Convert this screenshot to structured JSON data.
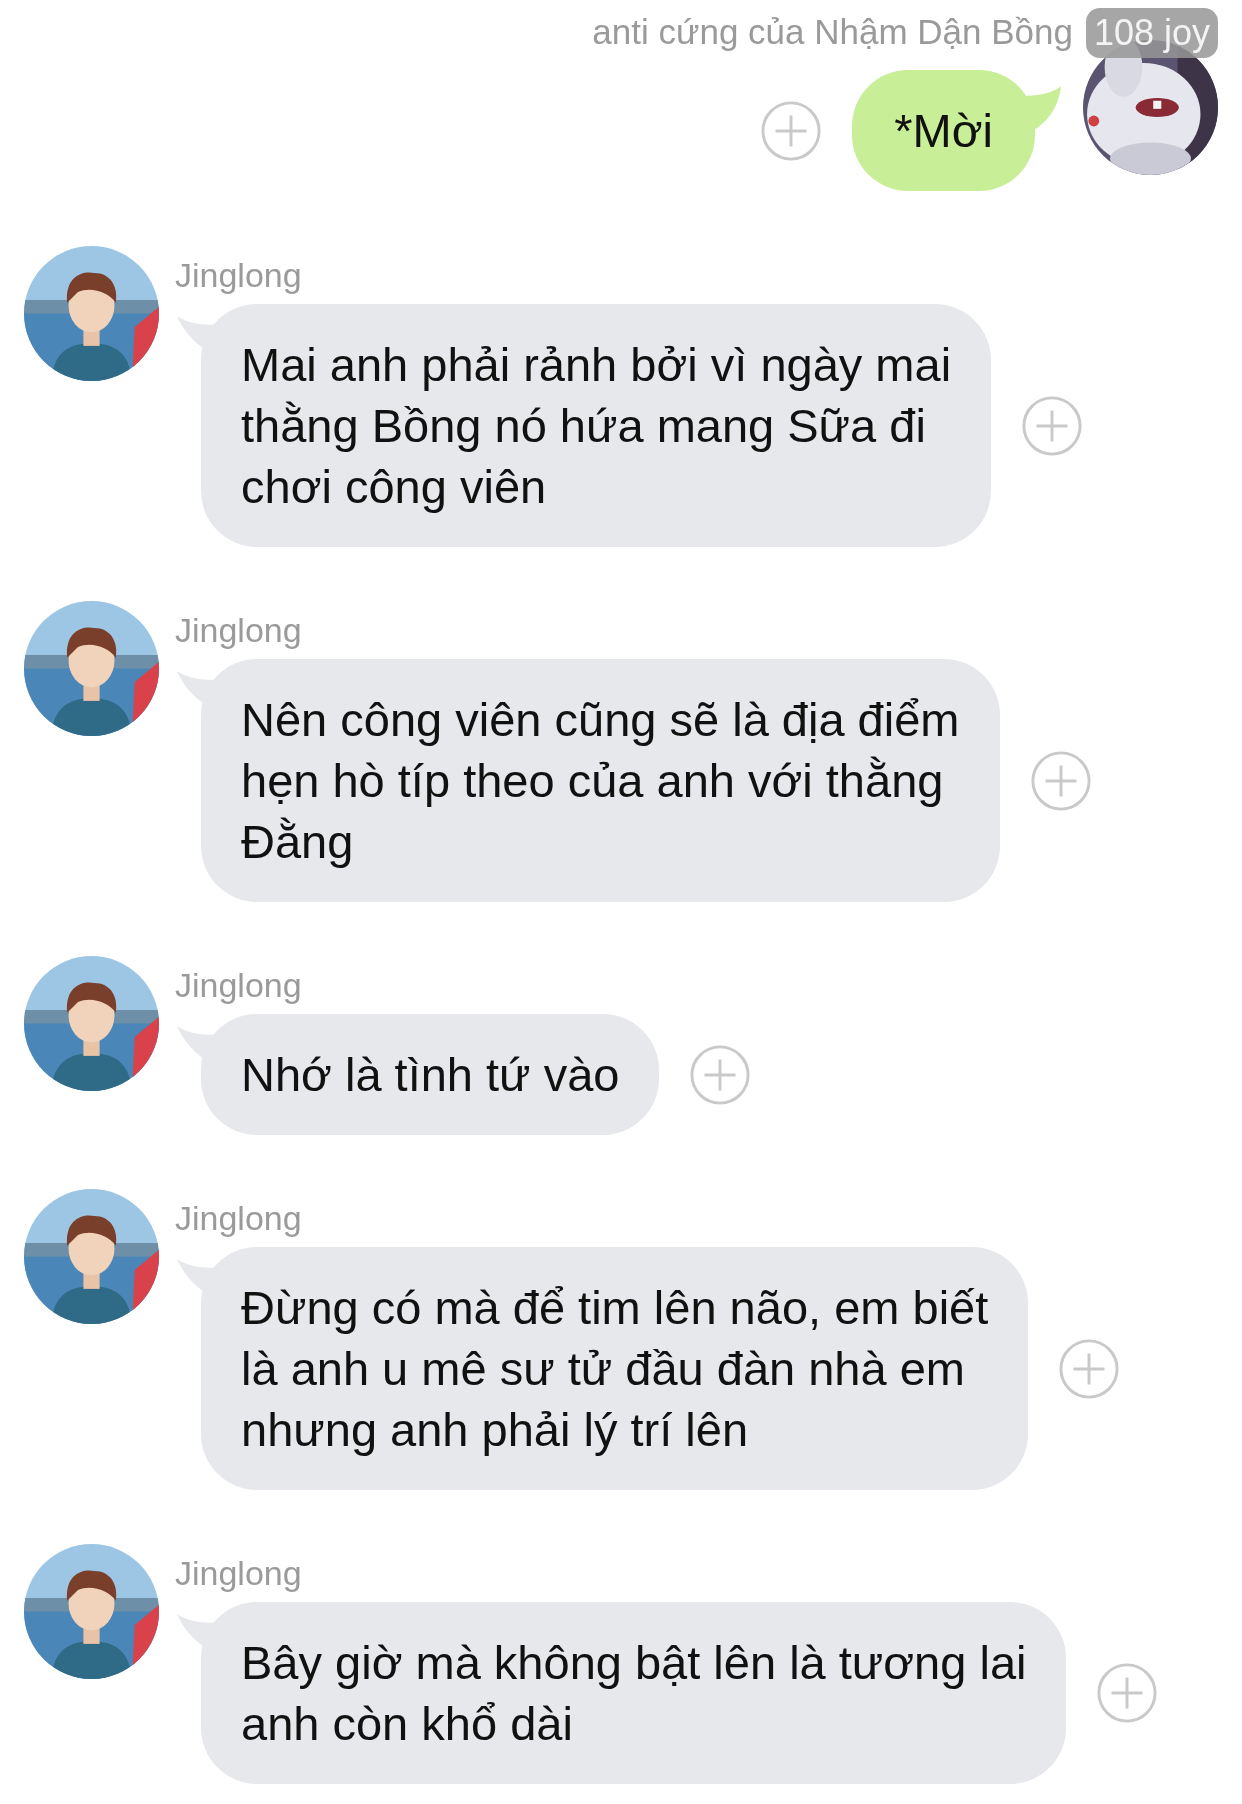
{
  "outgoing": {
    "sender": "anti cứng của Nhậm Dận Bồng",
    "badge": "108 joy",
    "text": "*Mời"
  },
  "messages": [
    {
      "sender": "Jinglong",
      "text": "Mai anh phải rảnh bởi vì ngày mai\nthằng Bồng nó hứa mang Sữa đi\nchơi công viên"
    },
    {
      "sender": "Jinglong",
      "text": "Nên công viên cũng sẽ là địa điểm\nhẹn hò típ theo của anh với thằng\nĐằng"
    },
    {
      "sender": "Jinglong",
      "text": "Nhớ là tình tứ vào"
    },
    {
      "sender": "Jinglong",
      "text": "Đừng có mà để tim lên não, em biết\nlà anh u mê sư tử đầu đàn nhà em\nnhưng anh phải lý trí lên"
    },
    {
      "sender": "Jinglong",
      "text": "Bây giờ mà không bật lên là tương lai\nanh còn khổ dài"
    }
  ]
}
